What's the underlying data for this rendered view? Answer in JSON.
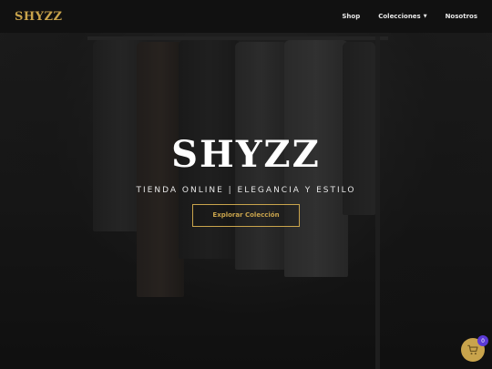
{
  "brand": {
    "name": "SHYZZ",
    "accent_color": "#c9a44c"
  },
  "nav": {
    "items": [
      {
        "label": "Shop"
      },
      {
        "label": "Colecciones",
        "has_dropdown": true
      },
      {
        "label": "Nosotros"
      }
    ]
  },
  "hero": {
    "title": "SHYZZ",
    "subtitle": "TIENDA ONLINE | ELEGANCIA Y ESTILO",
    "cta_label": "Explorar Colección"
  },
  "cart": {
    "icon": "shopping-cart-icon",
    "count": "0",
    "badge_color": "#5b3ad6"
  }
}
